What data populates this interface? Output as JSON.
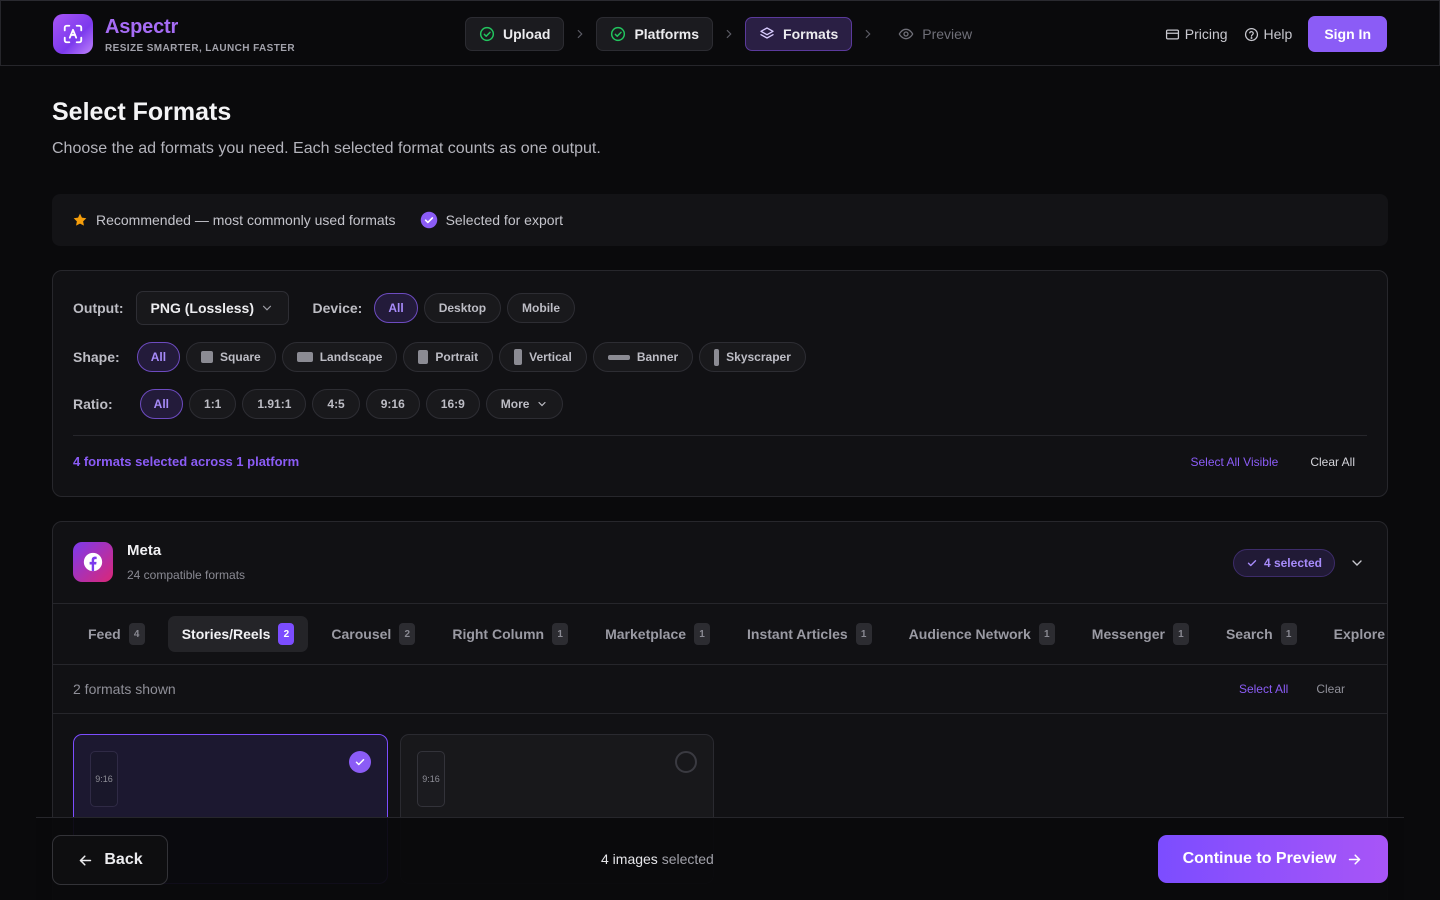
{
  "brand": {
    "name": "Aspectr",
    "tagline": "RESIZE SMARTER, LAUNCH FASTER",
    "icon": "logo-icon"
  },
  "steps": [
    {
      "label": "Upload",
      "state": "done",
      "icon": "check-circle-icon"
    },
    {
      "label": "Platforms",
      "state": "done",
      "icon": "check-circle-icon"
    },
    {
      "label": "Formats",
      "state": "active",
      "icon": "layers-icon"
    },
    {
      "label": "Preview",
      "state": "future",
      "icon": "eye-icon"
    }
  ],
  "nav": {
    "pricing": "Pricing",
    "help": "Help",
    "sign_in": "Sign In"
  },
  "page": {
    "title": "Select Formats",
    "subtitle": "Choose the ad formats you need. Each selected format counts as one output."
  },
  "legend": {
    "recommended": "Recommended — most commonly used formats",
    "selected": "Selected for export"
  },
  "filters": {
    "output_label": "Output:",
    "output_value": "PNG (Lossless)",
    "device_label": "Device:",
    "devices": [
      "All",
      "Desktop",
      "Mobile"
    ],
    "device_active": "All",
    "shape_label": "Shape:",
    "shapes": [
      "All",
      "Square",
      "Landscape",
      "Portrait",
      "Vertical",
      "Banner",
      "Skyscraper"
    ],
    "shape_active": "All",
    "ratio_label": "Ratio:",
    "ratios": [
      "All",
      "1:1",
      "1.91:1",
      "4:5",
      "9:16",
      "16:9"
    ],
    "ratio_more": "More",
    "ratio_active": "All",
    "summary": "4 formats selected across 1 platform",
    "select_all_visible": "Select All Visible",
    "clear_all": "Clear All"
  },
  "platform": {
    "name": "Meta",
    "compatible": "24 compatible formats",
    "selected_badge": "4 selected",
    "tabs": [
      {
        "label": "Feed",
        "count": "4"
      },
      {
        "label": "Stories/Reels",
        "count": "2",
        "active": true
      },
      {
        "label": "Carousel",
        "count": "2"
      },
      {
        "label": "Right Column",
        "count": "1"
      },
      {
        "label": "Marketplace",
        "count": "1"
      },
      {
        "label": "Instant Articles",
        "count": "1"
      },
      {
        "label": "Audience Network",
        "count": "1"
      },
      {
        "label": "Messenger",
        "count": "1"
      },
      {
        "label": "Search",
        "count": "1"
      },
      {
        "label": "Explore",
        "count": ""
      }
    ],
    "shown": "2 formats shown",
    "select_all": "Select All",
    "clear": "Clear",
    "formats": [
      {
        "ratio": "9:16",
        "selected": true
      },
      {
        "ratio": "9:16",
        "selected": false
      }
    ]
  },
  "footer": {
    "back": "Back",
    "status_count": "4 images",
    "status_suffix": " selected",
    "continue": "Continue to Preview"
  },
  "colors": {
    "accent": "#8b5cf6",
    "background": "#0a0a0c",
    "panel": "#111114",
    "star": "#f59e0b"
  }
}
